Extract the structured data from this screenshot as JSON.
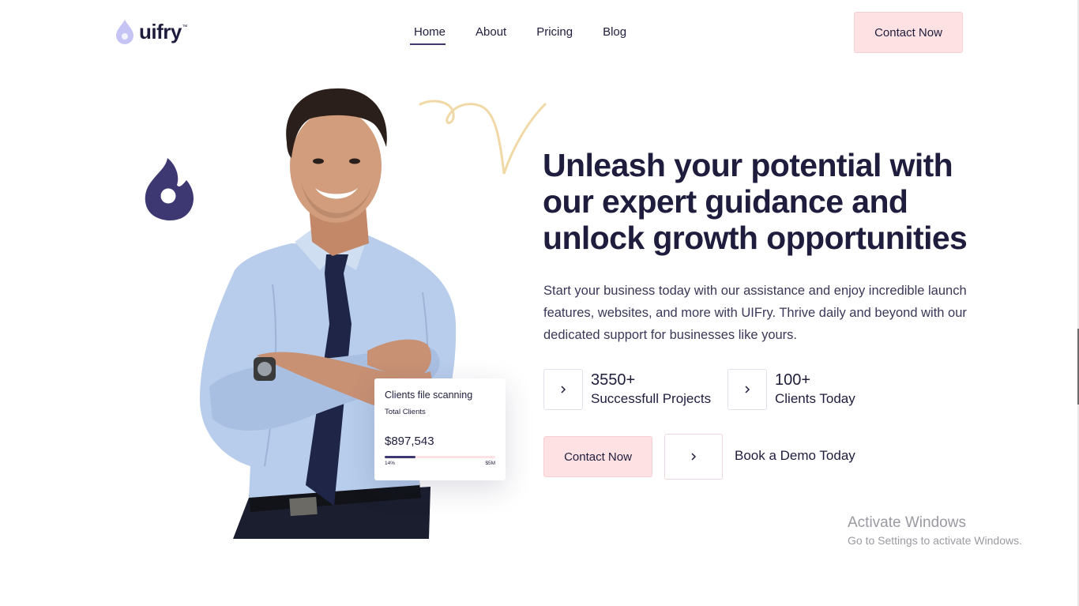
{
  "header": {
    "logo_text": "uifry",
    "logo_tm": "™",
    "nav": [
      {
        "label": "Home"
      },
      {
        "label": "About"
      },
      {
        "label": "Pricing"
      },
      {
        "label": "Blog"
      }
    ],
    "active_nav": "Home",
    "contact_label": "Contact Now"
  },
  "hero": {
    "headline": "Unleash your potential with our expert guidance and unlock growth opportunities",
    "description": "Start your business today with our assistance and enjoy incredible launch features, websites, and more with UIFry. Thrive daily and beyond with our dedicated support for businesses like yours.",
    "stats": [
      {
        "value": "3550+",
        "label": "Successfull Projects"
      },
      {
        "value": "100+",
        "label": "Clients Today"
      }
    ],
    "contact_label": "Contact Now",
    "demo_label": "Book a Demo Today"
  },
  "card": {
    "title": "Clients file scanning",
    "subtitle": "Total Clients",
    "amount": "$897,543",
    "progress_fraction": 0.28,
    "scale_min": "14%",
    "scale_max": "$5M"
  },
  "watermark": {
    "title": "Activate Windows",
    "subtitle": "Go to Settings to activate Windows."
  },
  "colors": {
    "brand_dark": "#1f1d3d",
    "brand_purple": "#3d3872",
    "accent_pink": "#fde1e3",
    "logo_light": "#c5c4f5",
    "squiggle": "#f0d9a6"
  },
  "icons": {
    "logo": "drop-icon",
    "decoration": "flame-icon",
    "arrows": "chevron-right-icon"
  }
}
